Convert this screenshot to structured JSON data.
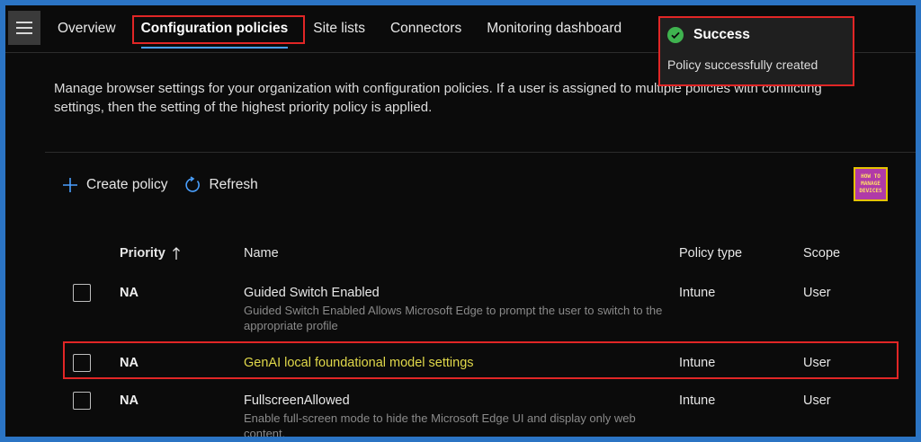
{
  "nav": {
    "tabs": [
      {
        "label": "Overview"
      },
      {
        "label": "Configuration policies"
      },
      {
        "label": "Site lists"
      },
      {
        "label": "Connectors"
      },
      {
        "label": "Monitoring dashboard"
      }
    ],
    "active_tab": "Configuration policies"
  },
  "description": "Manage browser settings for your organization with configuration policies. If a user is assigned to multiple policies with conflicting settings, then the setting of the highest priority policy is applied.",
  "toolbar": {
    "create_label": "Create policy",
    "refresh_label": "Refresh"
  },
  "logo": {
    "line1": "HOW TO",
    "line2": "MANAGE",
    "line3": "DEVICES"
  },
  "table": {
    "headers": {
      "priority": "Priority",
      "name": "Name",
      "type": "Policy type",
      "scope": "Scope"
    },
    "rows": [
      {
        "priority": "NA",
        "name": "Guided Switch Enabled",
        "desc": "Guided Switch Enabled Allows Microsoft Edge to prompt the user to switch to the appropriate profile",
        "type": "Intune",
        "scope": "User"
      },
      {
        "priority": "NA",
        "name": "GenAI local foundational model settings",
        "desc": "",
        "type": "Intune",
        "scope": "User"
      },
      {
        "priority": "NA",
        "name": "FullscreenAllowed",
        "desc": "Enable full-screen mode to hide the Microsoft Edge UI and display only web content.",
        "type": "Intune",
        "scope": "User"
      }
    ]
  },
  "toast": {
    "title": "Success",
    "message": "Policy successfully created"
  },
  "colors": {
    "accent": "#4aa0ff",
    "highlight": "#e12626",
    "success": "#3fb34f"
  }
}
